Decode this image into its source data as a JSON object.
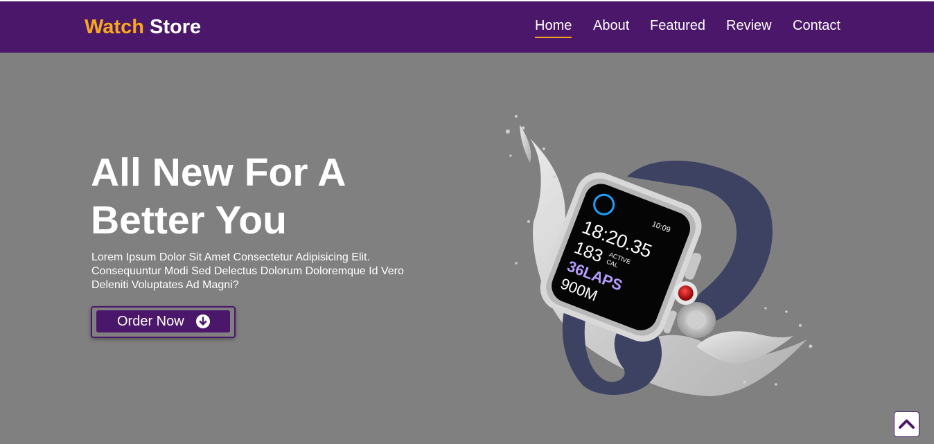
{
  "brand": {
    "first": "Watch",
    "second": "Store"
  },
  "nav": {
    "items": [
      {
        "label": "Home",
        "active": true
      },
      {
        "label": "About",
        "active": false
      },
      {
        "label": "Featured",
        "active": false
      },
      {
        "label": "Review",
        "active": false
      },
      {
        "label": "Contact",
        "active": false
      }
    ]
  },
  "hero": {
    "title_line1": "All New For A",
    "title_line2": "Better You",
    "description": "Lorem Ipsum Dolor Sit Amet Consectetur Adipisicing Elit. Consequuntur Modi Sed Delectus Dolorum Doloremque Id Vero Deleniti Voluptates Ad Magni?",
    "order_label": "Order Now",
    "order_icon": "arrow-down-circle-icon"
  },
  "watch_screen": {
    "time_small": "10:09",
    "time_big": "18:20.35",
    "cal_value": "183",
    "cal_label_1": "ACTIVE",
    "cal_label_2": "CAL",
    "laps": "36LAPS",
    "distance": "900M"
  },
  "scroll_top_icon": "chevron-up-icon",
  "colors": {
    "primary": "#4b176a",
    "accent": "#f7a81b",
    "background": "#808080",
    "text": "#ffffff"
  }
}
